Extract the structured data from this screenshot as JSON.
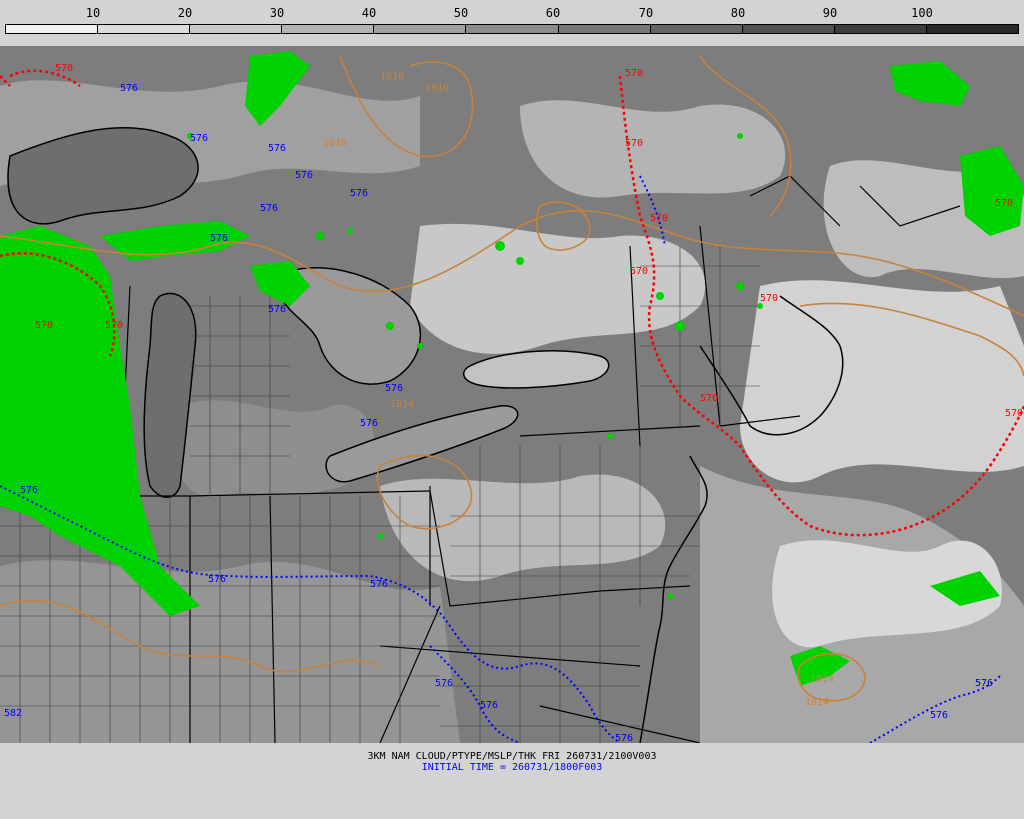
{
  "scale": {
    "ticks": [
      "10",
      "20",
      "30",
      "40",
      "50",
      "60",
      "70",
      "80",
      "90",
      "100"
    ],
    "segment_colors": [
      "#f0f0f0",
      "#dcdcdc",
      "#c8c8c8",
      "#b4b4b4",
      "#a0a0a0",
      "#8c8c8c",
      "#787878",
      "#646464",
      "#505050",
      "#3c3c3c",
      "#282828"
    ]
  },
  "caption": {
    "line1": "3KM NAM CLOUD/PTYPE/MSLP/THK FRI 260731/2100V003",
    "line2": "INITIAL TIME = 260731/1800F003"
  },
  "colors": {
    "thickness_570": "#ff0000",
    "thickness_576": "#0000ff",
    "isobar": "#c8823c",
    "precip_rain": "#00d200",
    "borders": "#000000"
  },
  "map_labels": {
    "red_570": "570",
    "blue_576": "576",
    "blue_582": "582",
    "isobar_1010": "1010",
    "isobar_1014": "1014"
  }
}
